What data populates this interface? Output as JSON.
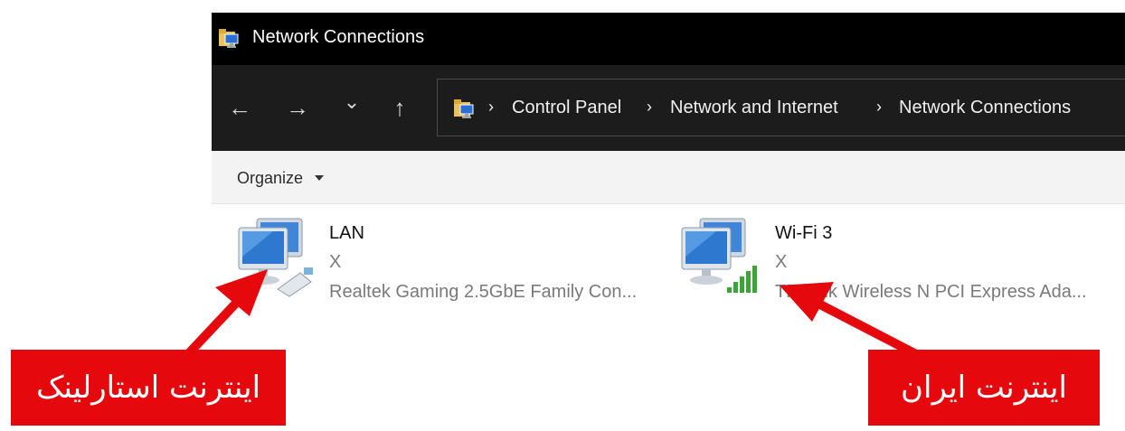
{
  "window": {
    "title": "Network Connections",
    "title_icon": "network-folder-icon"
  },
  "nav": {
    "back_icon": "back-arrow-icon",
    "forward_icon": "forward-arrow-icon",
    "recent_icon": "chevron-down-icon",
    "up_icon": "up-arrow-icon",
    "back_glyph": "←",
    "forward_glyph": "→",
    "recent_glyph": "⌄",
    "up_glyph": "↑"
  },
  "address_bar": {
    "separator": "›",
    "crumbs": [
      "Control Panel",
      "Network and Internet",
      "Network Connections"
    ]
  },
  "toolbar": {
    "organize_label": "Organize"
  },
  "connections": [
    {
      "name": "LAN",
      "status": "X",
      "device": "Realtek Gaming 2.5GbE Family Con...",
      "icon": "ethernet-adapter-icon"
    },
    {
      "name": "Wi-Fi 3",
      "status": "X",
      "device": "TP-Link Wireless N PCI Express Ada...",
      "icon": "wifi-adapter-icon"
    }
  ],
  "annotations": [
    {
      "text": "اینترنت استارلینک",
      "color": "#e5080d"
    },
    {
      "text": "اینترنت ایران",
      "color": "#e5080d"
    }
  ],
  "colors": {
    "titlebar": "#000000",
    "navbar": "#1c1c1c",
    "toolbar": "#f3f3f3",
    "annotation_red": "#e5080d"
  }
}
